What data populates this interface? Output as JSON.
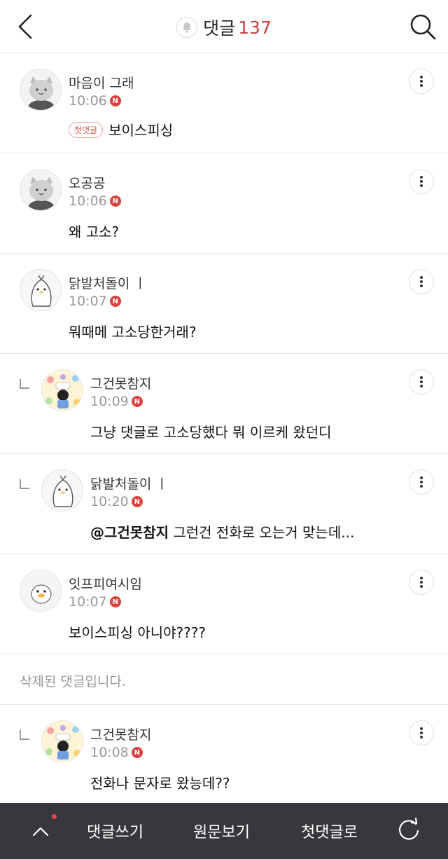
{
  "header": {
    "title": "댓글",
    "count": "137",
    "back_icon": "chevron-left-icon",
    "search_icon": "search-icon",
    "bell_icon": "bell-icon"
  },
  "comments": [
    {
      "nick": "마음이 그래",
      "time": "10:06",
      "new_badge": "N",
      "first_badge": "첫댓글",
      "body": "보이스피싱"
    },
    {
      "nick": "오공공",
      "time": "10:06",
      "new_badge": "N",
      "body": "왜 고소?"
    },
    {
      "nick": "닭발처돌이 ㅣ",
      "time": "10:07",
      "new_badge": "N",
      "body": "뭐때메 고소당한거래?"
    },
    {
      "nick": "그건못참지",
      "time": "10:09",
      "new_badge": "N",
      "body": "그냥 댓글로 고소당했다 뭐 이르케 왔던디"
    },
    {
      "nick": "닭발처돌이 ㅣ",
      "time": "10:20",
      "new_badge": "N",
      "mention": "@그건못참지",
      "body": " 그런건 전화로 오는거 맞는데..."
    },
    {
      "nick": "잇프피여시임",
      "time": "10:07",
      "new_badge": "N",
      "body": "보이스피싱 아니야????"
    },
    {
      "deleted": "삭제된 댓글입니다."
    },
    {
      "nick": "그건못참지",
      "time": "10:08",
      "new_badge": "N",
      "body": "전화나 문자로 왔능데??"
    }
  ],
  "bottom_bar": {
    "write": "댓글쓰기",
    "original": "원문보기",
    "first_comment": "첫댓글로",
    "up_icon": "chevron-up-icon",
    "refresh_icon": "refresh-icon"
  },
  "colors": {
    "accent": "#c8433f",
    "badge": "#d9423c",
    "bottom_bar": "#37373c"
  }
}
